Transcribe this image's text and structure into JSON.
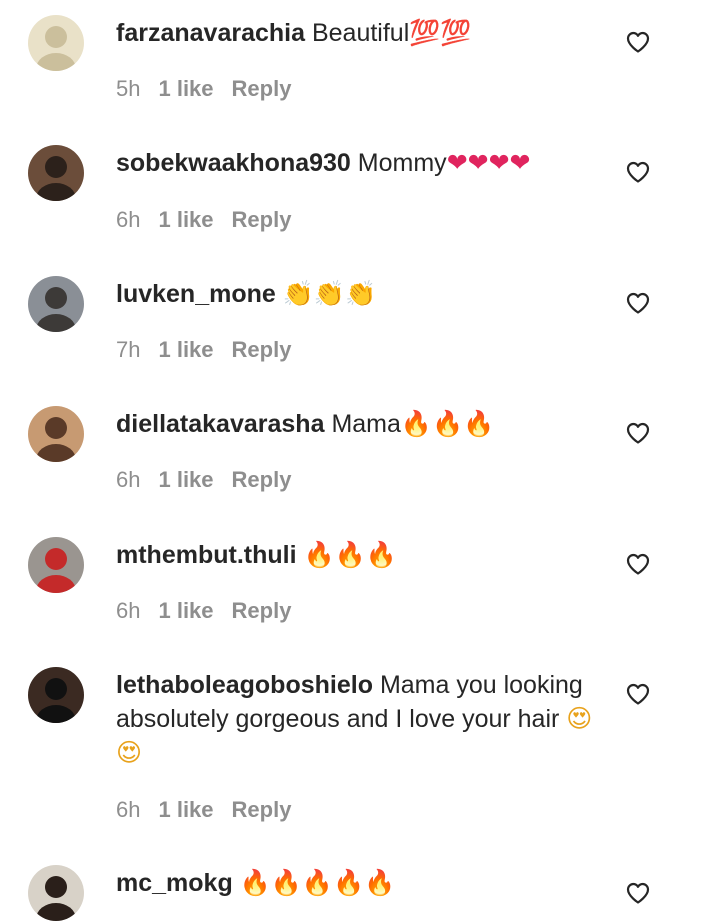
{
  "comments": [
    {
      "username": "farzanavarachia",
      "text": "Beautiful",
      "emoji": "💯💯",
      "emoji_color": "#e0245e",
      "time": "5h",
      "likes": "1 like",
      "reply": "Reply",
      "avatar_colors": [
        "#e9e1c8",
        "#cbbf9c"
      ]
    },
    {
      "username": "sobekwaakhona930",
      "text": "Mommy",
      "emoji": "❤❤❤❤",
      "emoji_color": "#e0245e",
      "time": "6h",
      "likes": "1 like",
      "reply": "Reply",
      "avatar_colors": [
        "#6b4d3a",
        "#2c211b"
      ]
    },
    {
      "username": "luvken_mone",
      "text": "",
      "emoji": "👏👏👏",
      "emoji_color": "#d9a020",
      "time": "7h",
      "likes": "1 like",
      "reply": "Reply",
      "avatar_colors": [
        "#8a8f96",
        "#3d3a38"
      ]
    },
    {
      "username": "diellatakavarasha",
      "text": "Mama",
      "emoji": "🔥🔥🔥",
      "emoji_color": "#f26a1b",
      "time": "6h",
      "likes": "1 like",
      "reply": "Reply",
      "avatar_colors": [
        "#c79a72",
        "#5a3a28"
      ]
    },
    {
      "username": "mthembut.thuli",
      "text": "",
      "emoji": "🔥🔥🔥",
      "emoji_color": "#f26a1b",
      "time": "6h",
      "likes": "1 like",
      "reply": "Reply",
      "avatar_colors": [
        "#9a9590",
        "#c42a2a"
      ]
    },
    {
      "username": "lethaboleagoboshielo",
      "text": "Mama you looking absolutely gorgeous and I love your hair",
      "emoji": "😍😍",
      "emoji_color": "#e8a21c",
      "time": "6h",
      "likes": "1 like",
      "reply": "Reply",
      "avatar_colors": [
        "#3b2a22",
        "#111111"
      ]
    },
    {
      "username": "mc_mokg",
      "text": "",
      "emoji": "🔥🔥🔥🔥🔥",
      "emoji_color": "#f26a1b",
      "time": "",
      "likes": "",
      "reply": "",
      "avatar_colors": [
        "#d8d2c8",
        "#2a1f1a"
      ]
    }
  ]
}
